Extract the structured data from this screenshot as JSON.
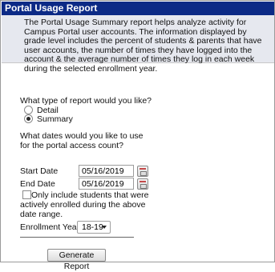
{
  "header": {
    "title": "Portal Usage Report"
  },
  "description": {
    "text": "The Portal Usage Summary report helps analyze activity for Campus Portal user accounts. The information displayed by grade level includes the percent of students & parents that have user accounts, the number of times they have logged into the account & the average number of times they log in each week during the selected enrollment year."
  },
  "report_type": {
    "question": "What type of report would you like?",
    "options": [
      {
        "label": "Detail",
        "selected": false
      },
      {
        "label": "Summary",
        "selected": true
      }
    ]
  },
  "dates": {
    "question": "What dates would you like to use for the portal access count?",
    "start_label": "Start Date",
    "start_value": "05/16/2019",
    "end_label": "End Date",
    "end_value": "05/16/2019",
    "enrolled_checkbox_label": "Only include students that were actively enrolled during the above date range.",
    "enrolled_checked": false
  },
  "enrollment_year": {
    "label": "Enrollment Year",
    "value": "18-19"
  },
  "actions": {
    "generate_label": "Generate Report"
  }
}
